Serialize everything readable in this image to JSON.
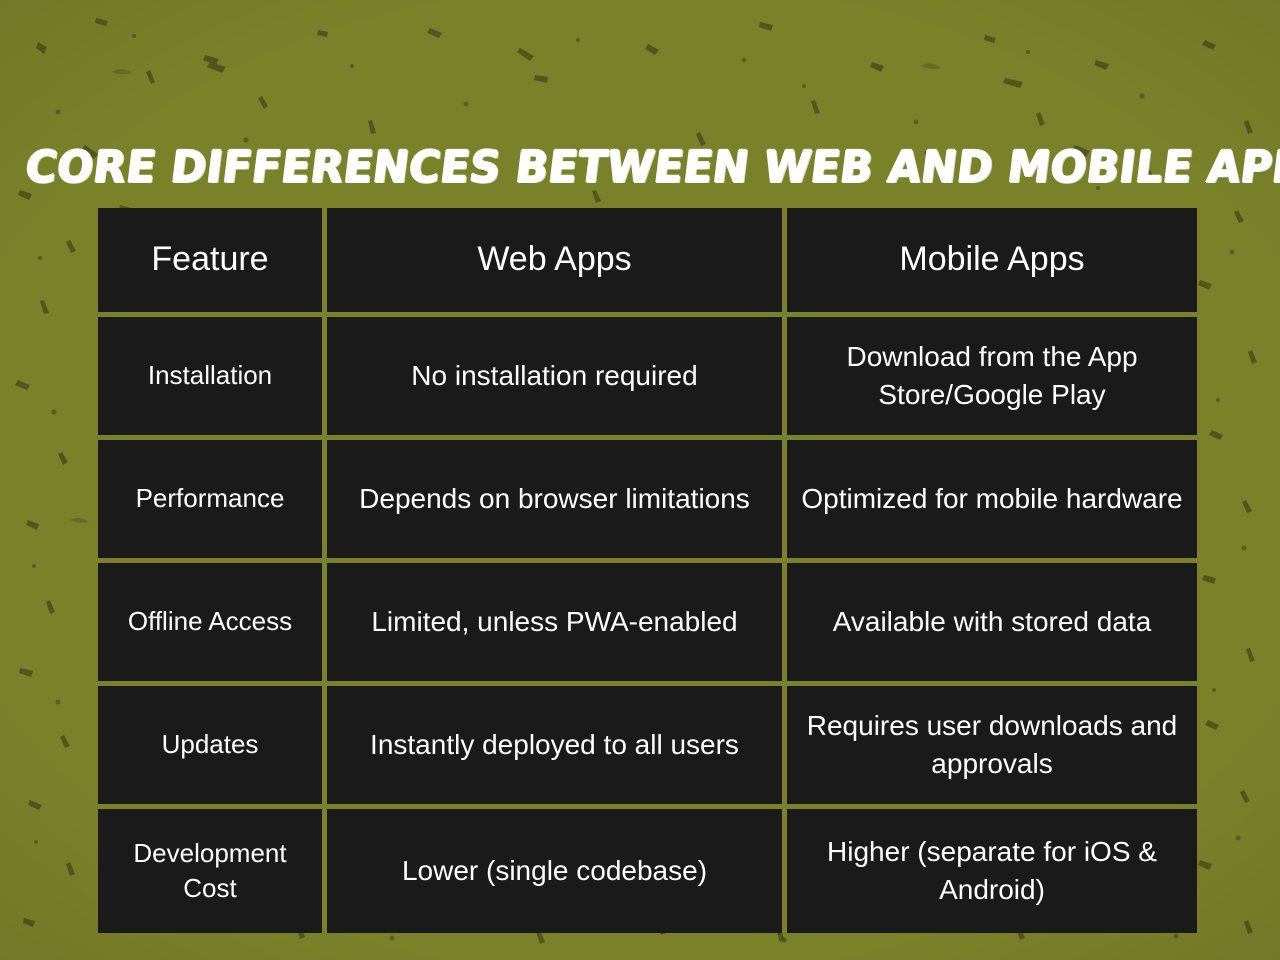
{
  "poster": {
    "title": "Core Differences Between Web and Mobile Apps",
    "background_color": "#798129",
    "cell_color": "#1a1a1a",
    "grid_color": "#798129",
    "text_color": "#ffffff"
  },
  "table": {
    "columns": [
      "Feature",
      "Web Apps",
      "Mobile Apps"
    ],
    "rows": [
      {
        "feature": "Installation",
        "web": "No installation required",
        "mobile": "Download from the App Store/Google Play"
      },
      {
        "feature": "Performance",
        "web": "Depends on browser limitations",
        "mobile": "Optimized for mobile hardware"
      },
      {
        "feature": "Offline Access",
        "web": "Limited, unless PWA-enabled",
        "mobile": "Available with stored data"
      },
      {
        "feature": "Updates",
        "web": "Instantly deployed to all users",
        "mobile": "Requires user downloads and approvals"
      },
      {
        "feature": "Development Cost",
        "web": "Lower (single codebase)",
        "mobile": "Higher (separate for iOS & Android)"
      }
    ]
  }
}
